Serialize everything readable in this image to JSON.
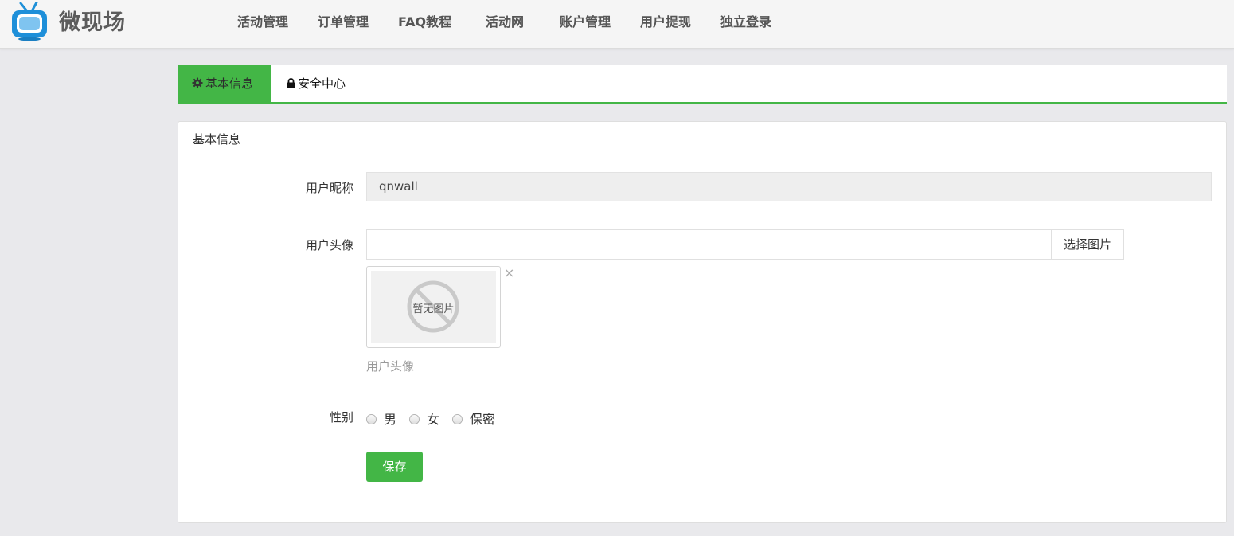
{
  "header": {
    "brand": "微现场",
    "nav": [
      {
        "label": "活动管理"
      },
      {
        "label": "订单管理"
      },
      {
        "label": "FAQ教程"
      },
      {
        "label": "活动网"
      },
      {
        "label": "账户管理"
      },
      {
        "label": "用户提现"
      },
      {
        "label": "独立登录"
      }
    ]
  },
  "tabs": [
    {
      "label": "基本信息",
      "icon": "gear-icon"
    },
    {
      "label": "安全中心",
      "icon": "lock-icon"
    }
  ],
  "panel": {
    "title": "基本信息",
    "nickname": {
      "label": "用户昵称",
      "value": "qnwall"
    },
    "avatar": {
      "label": "用户头像",
      "value": "",
      "pick_button": "选择图片",
      "placeholder_text": "暂无图片",
      "remove_symbol": "×",
      "help": "用户头像"
    },
    "gender": {
      "label": "性别",
      "options": [
        "男",
        "女",
        "保密"
      ],
      "selected": null
    },
    "save_label": "保存"
  },
  "colors": {
    "accent": "#43b646",
    "background": "#e9e9ec",
    "topbar": "#f5f5f5"
  }
}
